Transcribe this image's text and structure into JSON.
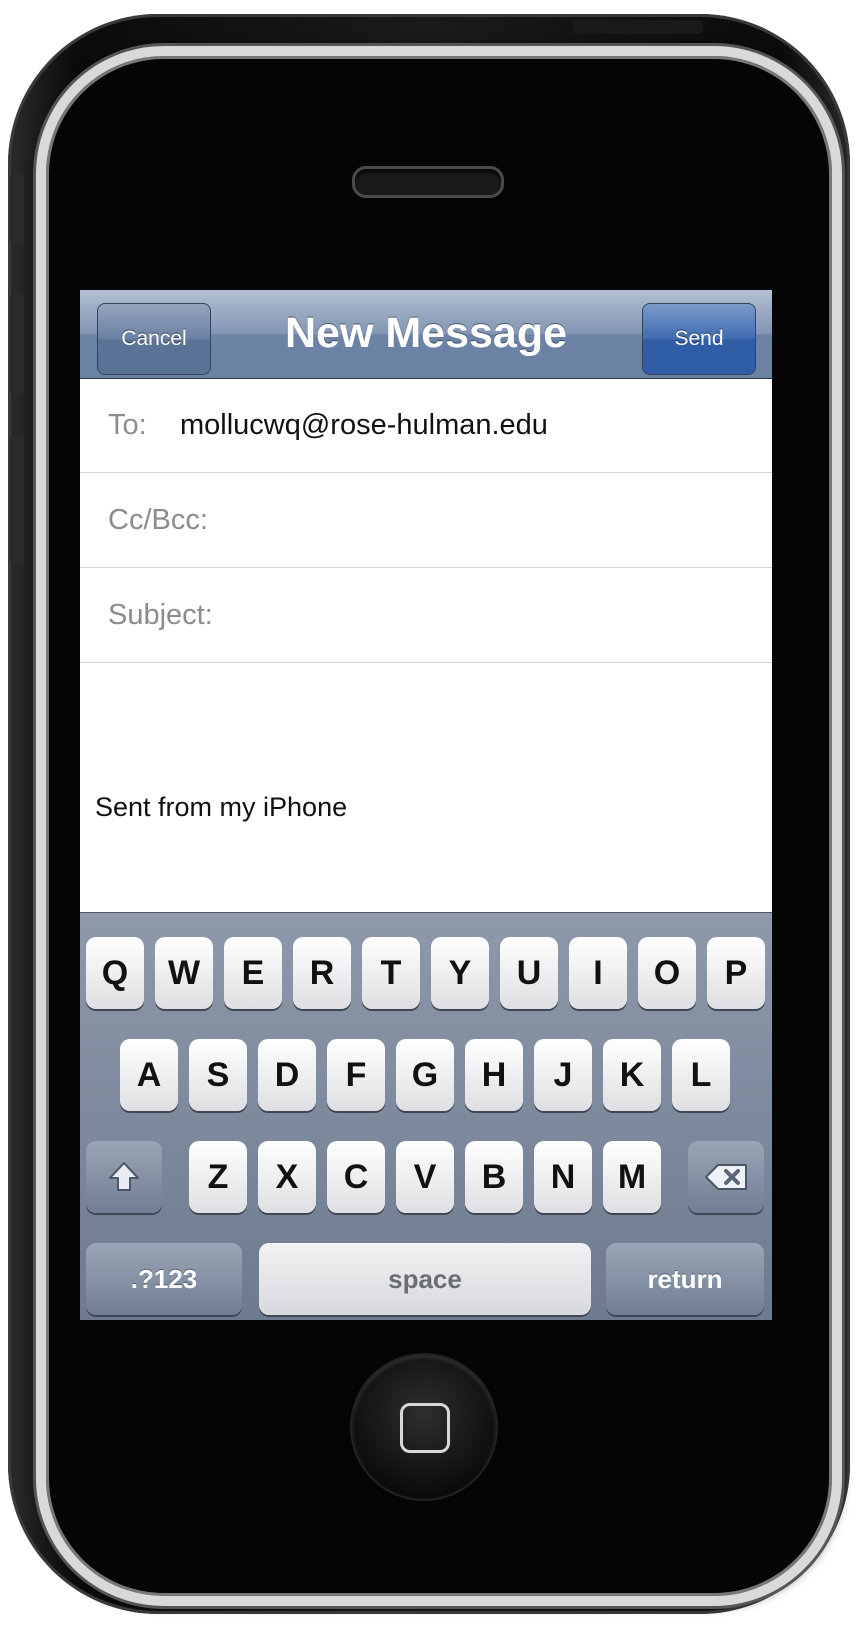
{
  "navbar": {
    "title": "New Message",
    "cancel_label": "Cancel",
    "send_label": "Send"
  },
  "fields": {
    "to_label": "To:",
    "to_value": "mollucwq@rose-hulman.edu",
    "ccbcc_label": "Cc/Bcc:",
    "subject_label": "Subject:"
  },
  "body": {
    "signature": "Sent from my iPhone"
  },
  "keyboard": {
    "row1": [
      "Q",
      "W",
      "E",
      "R",
      "T",
      "Y",
      "U",
      "I",
      "O",
      "P"
    ],
    "row2": [
      "A",
      "S",
      "D",
      "F",
      "G",
      "H",
      "J",
      "K",
      "L"
    ],
    "row3": [
      "Z",
      "X",
      "C",
      "V",
      "B",
      "N",
      "M"
    ],
    "numbers_label": ".?123",
    "space_label": "space",
    "return_label": "return",
    "shift_icon": "shift-icon",
    "delete_icon": "delete-icon"
  },
  "colors": {
    "navbar": "#8295b2",
    "send_button": "#3f6bb0",
    "keyboard": "#7d889b"
  }
}
